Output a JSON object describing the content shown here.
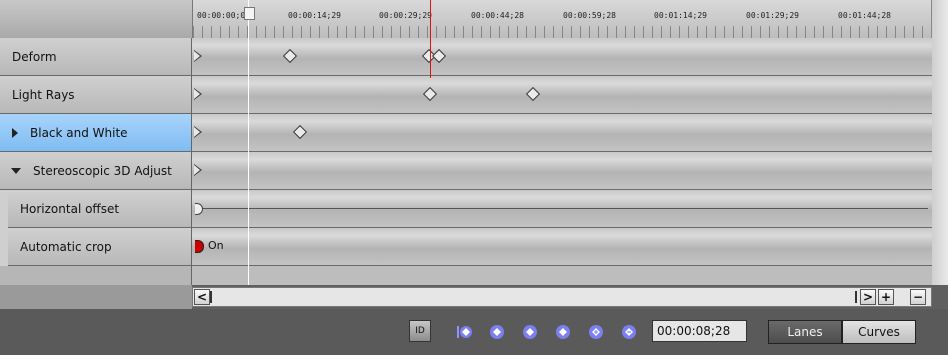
{
  "ruler": {
    "ticks": [
      "00:00:00;00",
      "00:00:14;29",
      "00:00:29;29",
      "00:00:44;28",
      "00:00:59;28",
      "00:01:14;29",
      "00:01:29;29",
      "00:01:44;28"
    ]
  },
  "tracks": {
    "deform": "Deform",
    "light_rays": "Light Rays",
    "black_white": "Black and White",
    "stereo": "Stereoscopic 3D Adjust",
    "horizontal_offset": "Horizontal offset",
    "automatic_crop": "Automatic crop"
  },
  "automatic_crop_value": "On",
  "toolbar": {
    "time": "00:00:08;28",
    "lanes": "Lanes",
    "curves": "Curves",
    "normalize_label": "ID"
  },
  "scrollbar": {
    "left": "<",
    "right": ">",
    "zoom_in": "+",
    "zoom_out": "−"
  },
  "colors": {
    "selected_row": "#8cc6f5",
    "play_cursor": "#d11111",
    "keyframe_nav": "#7b7ff0"
  }
}
